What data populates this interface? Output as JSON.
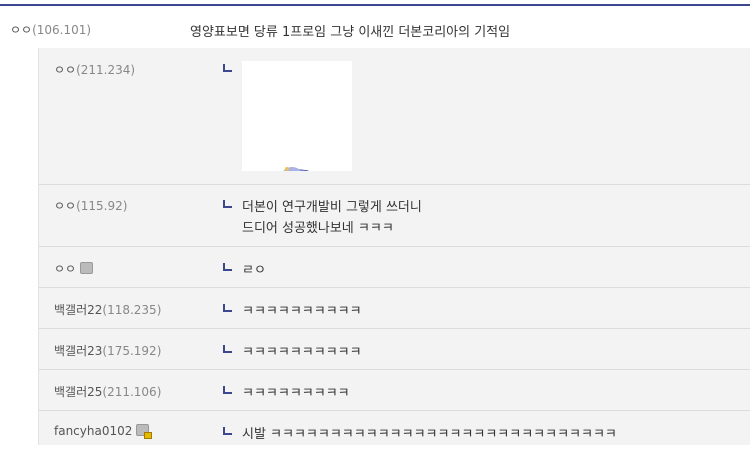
{
  "main_comment": {
    "name": "ㅇㅇ",
    "ip": "(106.101)",
    "text": "영양표보면 당류 1프로임 그냥 이새낀 더본코리아의 기적임"
  },
  "replies": [
    {
      "name": "ㅇㅇ",
      "ip": "(211.234)",
      "text": ""
    },
    {
      "name": "ㅇㅇ",
      "ip": "(115.92)",
      "line1": "더본이 연구개발비 그렇게 쓰더니",
      "line2": "드디어 성공했나보네 ㅋㅋㅋ"
    },
    {
      "name": "ㅇㅇ",
      "ip": "",
      "text": "ㄹㅇ"
    },
    {
      "name": "백갤러22",
      "ip": "(118.235)",
      "text": "ㅋㅋㅋㅋㅋㅋㅋㅋㅋㅋ"
    },
    {
      "name": "백갤러23",
      "ip": "(175.192)",
      "text": "ㅋㅋㅋㅋㅋㅋㅋㅋㅋㅋ"
    },
    {
      "name": "백갤러25",
      "ip": "(211.106)",
      "text": "ㅋㅋㅋㅋㅋㅋㅋㅋㅋ"
    },
    {
      "name": "fancyha0102",
      "ip": "",
      "text": "시발 ㅋㅋㅋㅋㅋㅋㅋㅋㅋㅋㅋㅋㅋㅋㅋㅋㅋㅋㅋㅋㅋㅋㅋㅋㅋㅋㅋㅋㅋ"
    }
  ],
  "icons": {
    "arrow": "reply-arrow-icon",
    "memo": "memo-icon",
    "sticker": "sticker-image"
  },
  "colors": {
    "accent": "#3b4890",
    "reply_bg": "#f3f3f3"
  }
}
